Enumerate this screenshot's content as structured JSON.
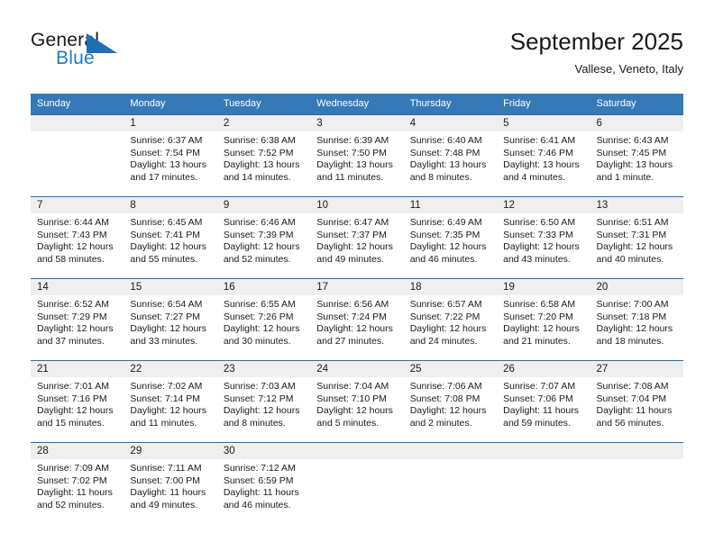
{
  "brand": {
    "name_part1": "General",
    "name_part2": "Blue",
    "accent_color": "#1f7ac4",
    "logo_icon": "triangle-flag-icon"
  },
  "header": {
    "title": "September 2025",
    "subtitle": "Vallese, Veneto, Italy"
  },
  "theme": {
    "header_row_bg": "#3679b8",
    "week_divider": "#2e6da4",
    "daynum_band_bg": "#efefef",
    "text": "#1a1a1a"
  },
  "weekday_headers": [
    "Sunday",
    "Monday",
    "Tuesday",
    "Wednesday",
    "Thursday",
    "Friday",
    "Saturday"
  ],
  "labels": {
    "sunrise": "Sunrise:",
    "sunset": "Sunset:",
    "daylight": "Daylight:"
  },
  "weeks": [
    [
      {
        "day": "",
        "sunrise": "",
        "sunset": "",
        "daylight_1": "",
        "daylight_2": ""
      },
      {
        "day": "1",
        "sunrise": "Sunrise: 6:37 AM",
        "sunset": "Sunset: 7:54 PM",
        "daylight_1": "Daylight: 13 hours",
        "daylight_2": "and 17 minutes."
      },
      {
        "day": "2",
        "sunrise": "Sunrise: 6:38 AM",
        "sunset": "Sunset: 7:52 PM",
        "daylight_1": "Daylight: 13 hours",
        "daylight_2": "and 14 minutes."
      },
      {
        "day": "3",
        "sunrise": "Sunrise: 6:39 AM",
        "sunset": "Sunset: 7:50 PM",
        "daylight_1": "Daylight: 13 hours",
        "daylight_2": "and 11 minutes."
      },
      {
        "day": "4",
        "sunrise": "Sunrise: 6:40 AM",
        "sunset": "Sunset: 7:48 PM",
        "daylight_1": "Daylight: 13 hours",
        "daylight_2": "and 8 minutes."
      },
      {
        "day": "5",
        "sunrise": "Sunrise: 6:41 AM",
        "sunset": "Sunset: 7:46 PM",
        "daylight_1": "Daylight: 13 hours",
        "daylight_2": "and 4 minutes."
      },
      {
        "day": "6",
        "sunrise": "Sunrise: 6:43 AM",
        "sunset": "Sunset: 7:45 PM",
        "daylight_1": "Daylight: 13 hours",
        "daylight_2": "and 1 minute."
      }
    ],
    [
      {
        "day": "7",
        "sunrise": "Sunrise: 6:44 AM",
        "sunset": "Sunset: 7:43 PM",
        "daylight_1": "Daylight: 12 hours",
        "daylight_2": "and 58 minutes."
      },
      {
        "day": "8",
        "sunrise": "Sunrise: 6:45 AM",
        "sunset": "Sunset: 7:41 PM",
        "daylight_1": "Daylight: 12 hours",
        "daylight_2": "and 55 minutes."
      },
      {
        "day": "9",
        "sunrise": "Sunrise: 6:46 AM",
        "sunset": "Sunset: 7:39 PM",
        "daylight_1": "Daylight: 12 hours",
        "daylight_2": "and 52 minutes."
      },
      {
        "day": "10",
        "sunrise": "Sunrise: 6:47 AM",
        "sunset": "Sunset: 7:37 PM",
        "daylight_1": "Daylight: 12 hours",
        "daylight_2": "and 49 minutes."
      },
      {
        "day": "11",
        "sunrise": "Sunrise: 6:49 AM",
        "sunset": "Sunset: 7:35 PM",
        "daylight_1": "Daylight: 12 hours",
        "daylight_2": "and 46 minutes."
      },
      {
        "day": "12",
        "sunrise": "Sunrise: 6:50 AM",
        "sunset": "Sunset: 7:33 PM",
        "daylight_1": "Daylight: 12 hours",
        "daylight_2": "and 43 minutes."
      },
      {
        "day": "13",
        "sunrise": "Sunrise: 6:51 AM",
        "sunset": "Sunset: 7:31 PM",
        "daylight_1": "Daylight: 12 hours",
        "daylight_2": "and 40 minutes."
      }
    ],
    [
      {
        "day": "14",
        "sunrise": "Sunrise: 6:52 AM",
        "sunset": "Sunset: 7:29 PM",
        "daylight_1": "Daylight: 12 hours",
        "daylight_2": "and 37 minutes."
      },
      {
        "day": "15",
        "sunrise": "Sunrise: 6:54 AM",
        "sunset": "Sunset: 7:27 PM",
        "daylight_1": "Daylight: 12 hours",
        "daylight_2": "and 33 minutes."
      },
      {
        "day": "16",
        "sunrise": "Sunrise: 6:55 AM",
        "sunset": "Sunset: 7:26 PM",
        "daylight_1": "Daylight: 12 hours",
        "daylight_2": "and 30 minutes."
      },
      {
        "day": "17",
        "sunrise": "Sunrise: 6:56 AM",
        "sunset": "Sunset: 7:24 PM",
        "daylight_1": "Daylight: 12 hours",
        "daylight_2": "and 27 minutes."
      },
      {
        "day": "18",
        "sunrise": "Sunrise: 6:57 AM",
        "sunset": "Sunset: 7:22 PM",
        "daylight_1": "Daylight: 12 hours",
        "daylight_2": "and 24 minutes."
      },
      {
        "day": "19",
        "sunrise": "Sunrise: 6:58 AM",
        "sunset": "Sunset: 7:20 PM",
        "daylight_1": "Daylight: 12 hours",
        "daylight_2": "and 21 minutes."
      },
      {
        "day": "20",
        "sunrise": "Sunrise: 7:00 AM",
        "sunset": "Sunset: 7:18 PM",
        "daylight_1": "Daylight: 12 hours",
        "daylight_2": "and 18 minutes."
      }
    ],
    [
      {
        "day": "21",
        "sunrise": "Sunrise: 7:01 AM",
        "sunset": "Sunset: 7:16 PM",
        "daylight_1": "Daylight: 12 hours",
        "daylight_2": "and 15 minutes."
      },
      {
        "day": "22",
        "sunrise": "Sunrise: 7:02 AM",
        "sunset": "Sunset: 7:14 PM",
        "daylight_1": "Daylight: 12 hours",
        "daylight_2": "and 11 minutes."
      },
      {
        "day": "23",
        "sunrise": "Sunrise: 7:03 AM",
        "sunset": "Sunset: 7:12 PM",
        "daylight_1": "Daylight: 12 hours",
        "daylight_2": "and 8 minutes."
      },
      {
        "day": "24",
        "sunrise": "Sunrise: 7:04 AM",
        "sunset": "Sunset: 7:10 PM",
        "daylight_1": "Daylight: 12 hours",
        "daylight_2": "and 5 minutes."
      },
      {
        "day": "25",
        "sunrise": "Sunrise: 7:06 AM",
        "sunset": "Sunset: 7:08 PM",
        "daylight_1": "Daylight: 12 hours",
        "daylight_2": "and 2 minutes."
      },
      {
        "day": "26",
        "sunrise": "Sunrise: 7:07 AM",
        "sunset": "Sunset: 7:06 PM",
        "daylight_1": "Daylight: 11 hours",
        "daylight_2": "and 59 minutes."
      },
      {
        "day": "27",
        "sunrise": "Sunrise: 7:08 AM",
        "sunset": "Sunset: 7:04 PM",
        "daylight_1": "Daylight: 11 hours",
        "daylight_2": "and 56 minutes."
      }
    ],
    [
      {
        "day": "28",
        "sunrise": "Sunrise: 7:09 AM",
        "sunset": "Sunset: 7:02 PM",
        "daylight_1": "Daylight: 11 hours",
        "daylight_2": "and 52 minutes."
      },
      {
        "day": "29",
        "sunrise": "Sunrise: 7:11 AM",
        "sunset": "Sunset: 7:00 PM",
        "daylight_1": "Daylight: 11 hours",
        "daylight_2": "and 49 minutes."
      },
      {
        "day": "30",
        "sunrise": "Sunrise: 7:12 AM",
        "sunset": "Sunset: 6:59 PM",
        "daylight_1": "Daylight: 11 hours",
        "daylight_2": "and 46 minutes."
      },
      {
        "day": "",
        "sunrise": "",
        "sunset": "",
        "daylight_1": "",
        "daylight_2": ""
      },
      {
        "day": "",
        "sunrise": "",
        "sunset": "",
        "daylight_1": "",
        "daylight_2": ""
      },
      {
        "day": "",
        "sunrise": "",
        "sunset": "",
        "daylight_1": "",
        "daylight_2": ""
      },
      {
        "day": "",
        "sunrise": "",
        "sunset": "",
        "daylight_1": "",
        "daylight_2": ""
      }
    ]
  ]
}
